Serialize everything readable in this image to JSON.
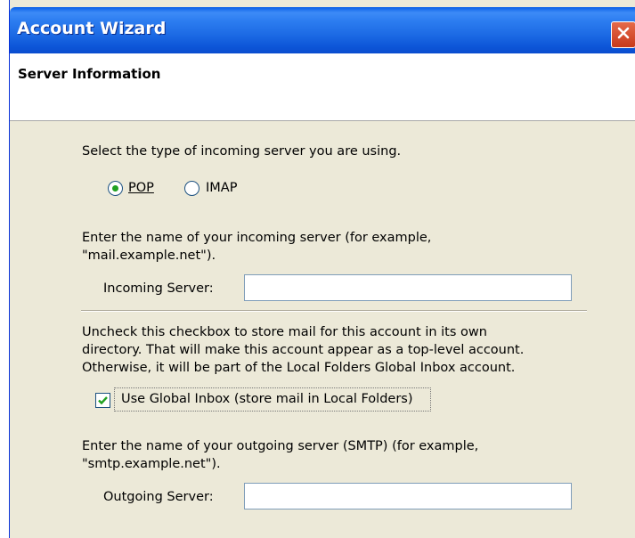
{
  "window": {
    "title": "Account Wizard",
    "close_icon": "close-x-icon"
  },
  "header": {
    "title": "Server Information"
  },
  "incoming_type": {
    "prompt": "Select the type of incoming server you are using.",
    "options": [
      {
        "label": "POP",
        "selected": true
      },
      {
        "label": "IMAP",
        "selected": false
      }
    ]
  },
  "incoming_server": {
    "description_line1": "Enter the name of your incoming server (for example,",
    "description_line2": "\"mail.example.net\").",
    "label": "Incoming Server:",
    "value": ""
  },
  "global_inbox": {
    "description_line1": "Uncheck this checkbox to store mail for this account in its own",
    "description_line2": "directory. That will make this account appear as a top-level account.",
    "description_line3": "Otherwise, it will be part of the Local Folders Global Inbox account.",
    "checkbox_label": "Use Global Inbox (store mail in Local Folders)",
    "checked": true
  },
  "outgoing_server": {
    "description_line1": "Enter the name of your outgoing server (SMTP) (for example,",
    "description_line2": "\"smtp.example.net\").",
    "label": "Outgoing Server:",
    "value": ""
  },
  "colors": {
    "titlebar": "#1c6ae4",
    "dialog_bg": "#ece9d8",
    "radio_dot": "#21a121",
    "check_mark": "#21a121",
    "close_button": "#c8391b"
  }
}
